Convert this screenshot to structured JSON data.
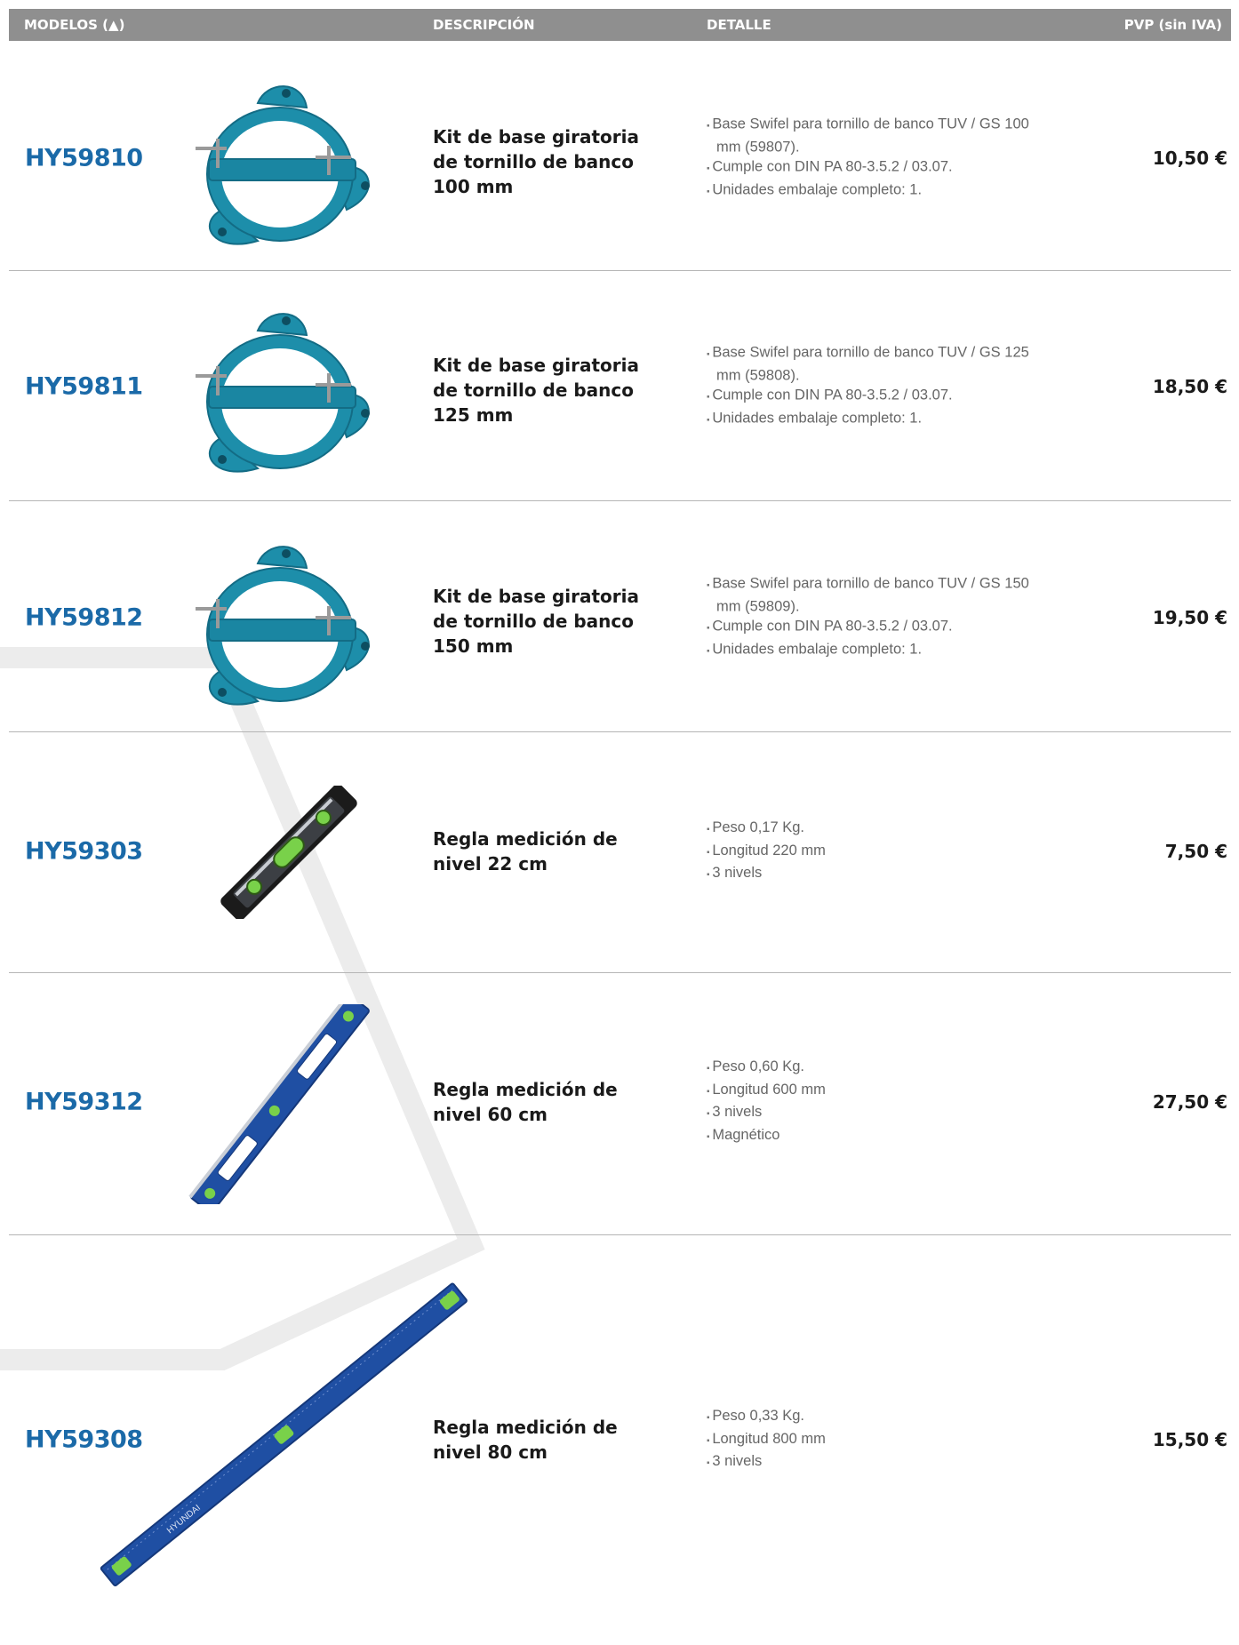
{
  "header": {
    "model": "MODELOS (▲)",
    "description": "DESCRIPCIÓN",
    "detail": "DETALLE",
    "price": "PVP (sin IVA)"
  },
  "products": [
    {
      "code": "HY59810",
      "image_icon": "swivel-base-icon",
      "description": "Kit de base giratoria de tornillo de banco 100 mm",
      "details": [
        "Base Swifel para tornillo de banco TUV / GS 100 mm (59807).",
        "Cumple con DIN PA 80-3.5.2 / 03.07.",
        "Unidades embalaje completo: 1."
      ],
      "price": "10,50 €"
    },
    {
      "code": "HY59811",
      "image_icon": "swivel-base-icon",
      "description": "Kit de base giratoria de tornillo de banco 125 mm",
      "details": [
        "Base Swifel para tornillo de banco TUV / GS 125 mm (59808).",
        "Cumple con DIN PA 80-3.5.2 / 03.07.",
        "Unidades embalaje completo: 1."
      ],
      "price": "18,50 €"
    },
    {
      "code": "HY59812",
      "image_icon": "swivel-base-icon",
      "description": "Kit de base giratoria de tornillo de banco 150 mm",
      "details": [
        "Base Swifel para tornillo de banco TUV / GS 150 mm (59809).",
        "Cumple con DIN PA 80-3.5.2 / 03.07.",
        "Unidades embalaje completo: 1."
      ],
      "price": "19,50 €"
    },
    {
      "code": "HY59303",
      "image_icon": "torpedo-level-icon",
      "description": "Regla medición de nivel 22 cm",
      "details": [
        "Peso 0,17 Kg.",
        "Longitud 220 mm",
        "3 nivels"
      ],
      "price": "7,50 €"
    },
    {
      "code": "HY59312",
      "image_icon": "box-level-icon",
      "description": "Regla medición de nivel 60 cm",
      "details": [
        "Peso 0,60 Kg.",
        "Longitud 600 mm",
        "3 nivels",
        "Magnético"
      ],
      "price": "27,50 €"
    },
    {
      "code": "HY59308",
      "image_icon": "long-level-icon",
      "description": "Regla medición de nivel 80 cm",
      "details": [
        "Peso 0,33 Kg.",
        "Longitud 800 mm",
        "3 nivels"
      ],
      "price": "15,50 €",
      "brand_text": "HYUNDAI"
    }
  ],
  "colors": {
    "header_bg": "#8f8f8f",
    "code": "#1b6aa8",
    "swivel_base": "#1d8eaa",
    "level_blue": "#1f4fa3",
    "level_black": "#1b1b1b"
  }
}
